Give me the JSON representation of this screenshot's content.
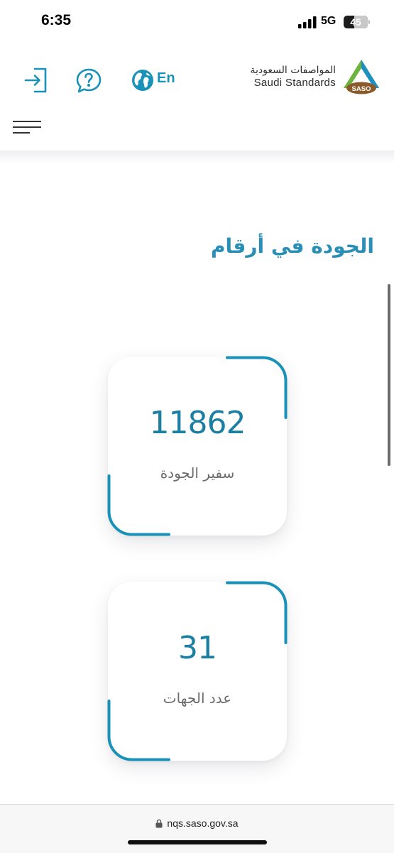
{
  "status_bar": {
    "time": "6:35",
    "network": "5G",
    "battery_level": 45,
    "battery_text": "45",
    "icons": [
      "signal-bars-icon",
      "battery-icon"
    ]
  },
  "header": {
    "brand": {
      "name_ar": "المواصفات السعودية",
      "name_en": "Saudi Standards",
      "logo_text": "SASO"
    },
    "language_label": "En",
    "icons": [
      "login-icon",
      "help-icon",
      "globe-icon",
      "hamburger-menu-icon"
    ]
  },
  "main": {
    "section_title": "الجودة في أرقام",
    "stats": [
      {
        "value": "11862",
        "label": "سفير الجودة"
      },
      {
        "value": "31",
        "label": "عدد الجهات"
      }
    ]
  },
  "browser": {
    "url": "nqs.saso.gov.sa",
    "icons": [
      "lock-icon"
    ]
  },
  "colors": {
    "accent": "#1a92b8",
    "title": "#2a8fb6",
    "stat_value": "#1a7fa2",
    "logo_green": "#6db33f",
    "logo_blue": "#1d8fc0",
    "logo_brown": "#8b5a2b"
  }
}
